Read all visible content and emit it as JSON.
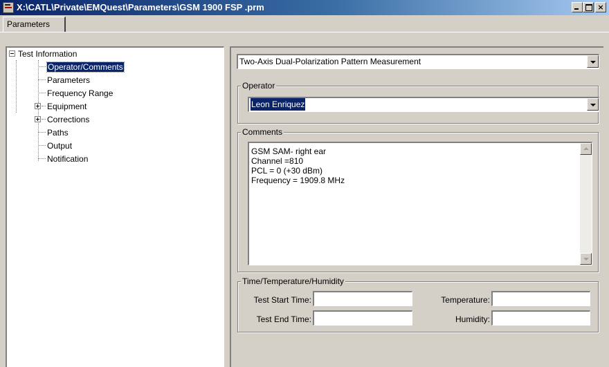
{
  "window": {
    "title": "X:\\CATL\\Private\\EMQuest\\Parameters\\GSM 1900 FSP .prm"
  },
  "tabs": [
    {
      "label": "Parameters"
    }
  ],
  "tree": {
    "items": [
      {
        "label": "Test Information",
        "expander": "minus"
      },
      {
        "label": "Operator/Comments",
        "selected": true
      },
      {
        "label": "Parameters"
      },
      {
        "label": "Frequency Range"
      },
      {
        "label": "Equipment",
        "expander": "plus"
      },
      {
        "label": "Corrections",
        "expander": "plus"
      },
      {
        "label": "Paths"
      },
      {
        "label": "Output"
      },
      {
        "label": "Notification"
      }
    ]
  },
  "measurement_type": {
    "value": "Two-Axis Dual-Polarization Pattern Measurement"
  },
  "operator": {
    "label": "Operator",
    "value": "Leon Enriquez"
  },
  "comments": {
    "label": "Comments",
    "lines": [
      "GSM SAM- right ear",
      "Channel =810",
      "PCL = 0 (+30 dBm)",
      "Frequency =  1909.8 MHz"
    ]
  },
  "time_temp_humidity": {
    "label": "Time/Temperature/Humidity",
    "test_start_time": {
      "label": "Test Start Time:",
      "value": ""
    },
    "test_end_time": {
      "label": "Test End Time:",
      "value": ""
    },
    "temperature": {
      "label": "Temperature:",
      "value": ""
    },
    "humidity": {
      "label": "Humidity:",
      "value": ""
    }
  }
}
